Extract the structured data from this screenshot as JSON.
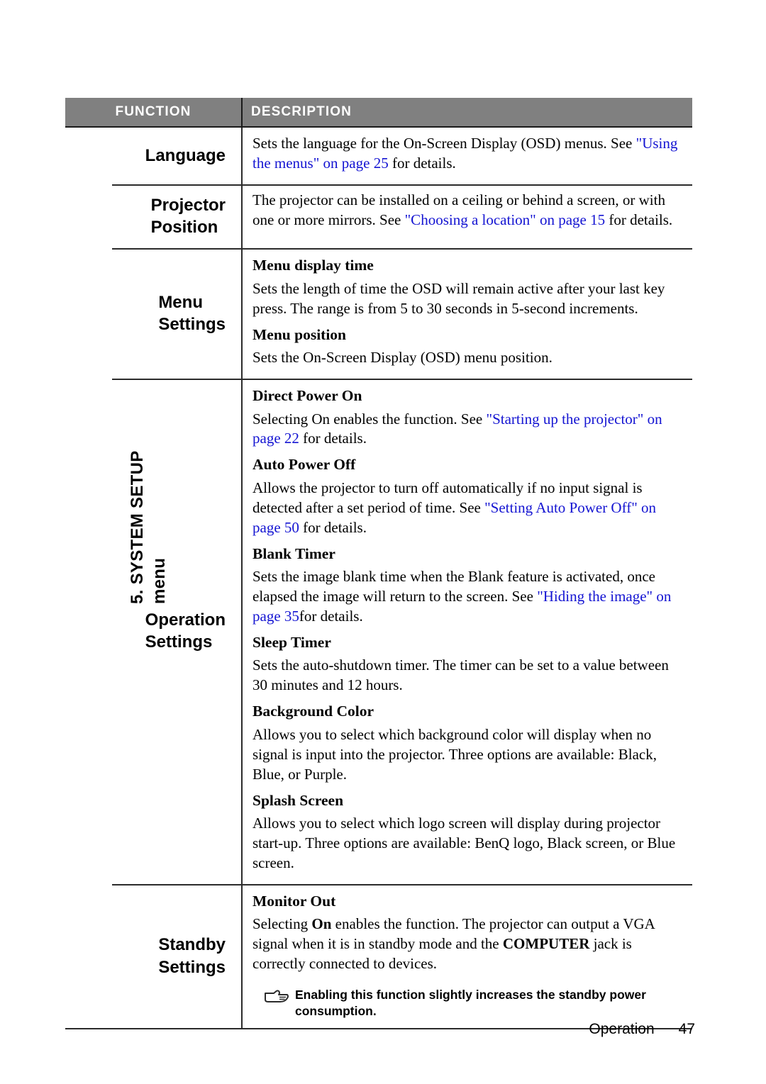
{
  "page": {
    "side_label_line1": "5. SYSTEM SETUP",
    "side_label_line2": "menu",
    "footer_section": "Operation",
    "footer_page_number": "47",
    "header_bg_color": "#808080",
    "link_color": "#1414d2"
  },
  "table": {
    "headers": {
      "function": "FUNCTION",
      "description": "DESCRIPTION"
    },
    "rows": [
      {
        "function": "Language",
        "blocks": [
          {
            "subheading": null,
            "paragraphs": [
              {
                "runs": [
                  {
                    "text": "Sets the language for the On-Screen Display (OSD) menus. See ",
                    "style": "normal"
                  },
                  {
                    "text": "\"Using the menus\" on page 25",
                    "style": "link"
                  },
                  {
                    "text": " for details.",
                    "style": "normal"
                  }
                ]
              }
            ]
          }
        ]
      },
      {
        "function": "Projector Position",
        "blocks": [
          {
            "subheading": null,
            "paragraphs": [
              {
                "runs": [
                  {
                    "text": "The projector can be installed on a ceiling or behind a screen, or with one or more mirrors. See ",
                    "style": "normal"
                  },
                  {
                    "text": "\"Choosing a location\" on page 15",
                    "style": "link"
                  },
                  {
                    "text": " for details.",
                    "style": "normal"
                  }
                ]
              }
            ]
          }
        ]
      },
      {
        "function": "Menu Settings",
        "blocks": [
          {
            "subheading": "Menu display time",
            "paragraphs": [
              {
                "runs": [
                  {
                    "text": "Sets the length of time the OSD will remain active after your last key press. The range is from 5 to 30 seconds in 5-second increments.",
                    "style": "normal"
                  }
                ]
              }
            ]
          },
          {
            "subheading": "Menu position",
            "paragraphs": [
              {
                "runs": [
                  {
                    "text": "Sets the On-Screen Display (OSD) menu position.",
                    "style": "normal"
                  }
                ]
              }
            ]
          }
        ]
      },
      {
        "function": "Operation Settings",
        "blocks": [
          {
            "subheading": "Direct Power On",
            "paragraphs": [
              {
                "runs": [
                  {
                    "text": "Selecting On enables the function. See ",
                    "style": "normal"
                  },
                  {
                    "text": "\"Starting up the projector\" on page 22",
                    "style": "link"
                  },
                  {
                    "text": " for details.",
                    "style": "normal"
                  }
                ]
              }
            ]
          },
          {
            "subheading": "Auto Power Off",
            "paragraphs": [
              {
                "runs": [
                  {
                    "text": "Allows the projector to turn off automatically if no input signal is detected after a set period of time. See ",
                    "style": "normal"
                  },
                  {
                    "text": "\"Setting Auto Power Off\" on page 50",
                    "style": "link"
                  },
                  {
                    "text": " for details.",
                    "style": "normal"
                  }
                ]
              }
            ]
          },
          {
            "subheading": "Blank Timer",
            "paragraphs": [
              {
                "runs": [
                  {
                    "text": "Sets the image blank time when the Blank feature is activated, once elapsed the image will return to the screen. See ",
                    "style": "normal"
                  },
                  {
                    "text": "\"Hiding the image\" on page 35",
                    "style": "link"
                  },
                  {
                    "text": "for details.",
                    "style": "normal"
                  }
                ]
              }
            ]
          },
          {
            "subheading": "Sleep Timer",
            "paragraphs": [
              {
                "runs": [
                  {
                    "text": "Sets the auto-shutdown timer. The timer can be set to a value between 30 minutes and 12 hours.",
                    "style": "normal"
                  }
                ]
              }
            ]
          },
          {
            "subheading": "Background Color",
            "paragraphs": [
              {
                "runs": [
                  {
                    "text": "Allows you to select which background color will display when no signal is input into the projector. Three options are available: Black, Blue, or Purple.",
                    "style": "normal"
                  }
                ]
              }
            ]
          },
          {
            "subheading": "Splash Screen",
            "paragraphs": [
              {
                "runs": [
                  {
                    "text": "Allows you to select which logo screen will display during projector start-up. Three options are available: BenQ logo, Black screen, or Blue screen.",
                    "style": "normal"
                  }
                ]
              }
            ]
          }
        ]
      },
      {
        "function": "Standby Settings",
        "blocks": [
          {
            "subheading": "Monitor Out",
            "paragraphs": [
              {
                "runs": [
                  {
                    "text": "Selecting ",
                    "style": "normal"
                  },
                  {
                    "text": "On",
                    "style": "bold"
                  },
                  {
                    "text": " enables the function. The projector can output a VGA signal when it is in standby mode and the ",
                    "style": "normal"
                  },
                  {
                    "text": "COMPUTER",
                    "style": "bold"
                  },
                  {
                    "text": " jack is correctly connected to devices.",
                    "style": "normal"
                  }
                ]
              }
            ]
          }
        ],
        "note": {
          "icon": "pointing-hand-icon",
          "text": "Enabling this function slightly increases the standby power consumption."
        }
      }
    ]
  }
}
